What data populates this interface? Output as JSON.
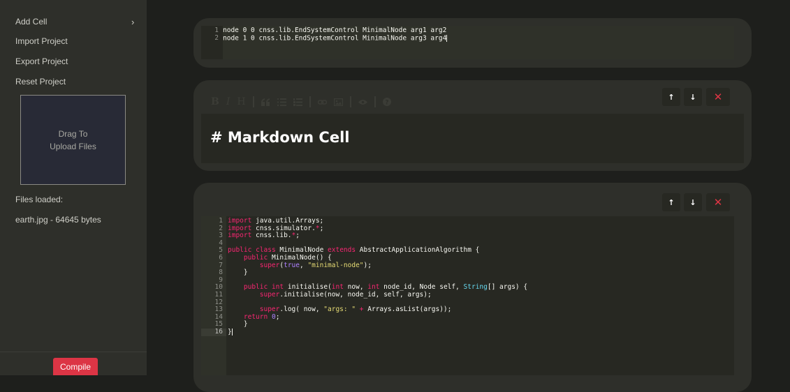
{
  "sidebar": {
    "items": [
      {
        "label": "Add Cell"
      },
      {
        "label": "Import Project"
      },
      {
        "label": "Export Project"
      },
      {
        "label": "Reset Project"
      }
    ],
    "dropzone": {
      "line1": "Drag To",
      "line2": "Upload Files"
    },
    "files_label": "Files loaded:",
    "files": [
      "earth.jpg - 64645 bytes"
    ],
    "compile_label": "Compile"
  },
  "cells": {
    "topology": {
      "lines": [
        "node 0 0 cnss.lib.EndSystemControl MinimalNode arg1 arg2",
        "node 1 0 cnss.lib.EndSystemControl MinimalNode arg3 arg4"
      ],
      "line_numbers": [
        "1",
        "2"
      ]
    },
    "markdown": {
      "content": "# Markdown Cell",
      "toolbar_icons": [
        "bold-icon",
        "italic-icon",
        "heading-icon",
        "quote-icon",
        "unordered-list-icon",
        "ordered-list-icon",
        "link-icon",
        "image-icon",
        "preview-icon",
        "guide-icon"
      ]
    },
    "code": {
      "line_numbers": [
        "1",
        "2",
        "3",
        "4",
        "5",
        "6",
        "7",
        "8",
        "9",
        "10",
        "11",
        "12",
        "13",
        "14",
        "15",
        "16"
      ],
      "active_line": 16
    },
    "buttons": {
      "up": "↑",
      "down": "↓",
      "delete": "✕"
    }
  },
  "colors": {
    "background": "#1e1f1c",
    "sidebar": "#2e2f2a",
    "cell": "#2e2f2a",
    "editor": "#272822",
    "compile": "#dc3545",
    "delete": "#e03545",
    "keyword": "#f92672",
    "string": "#e6db74",
    "number": "#ae81ff",
    "type": "#66d9ef"
  }
}
